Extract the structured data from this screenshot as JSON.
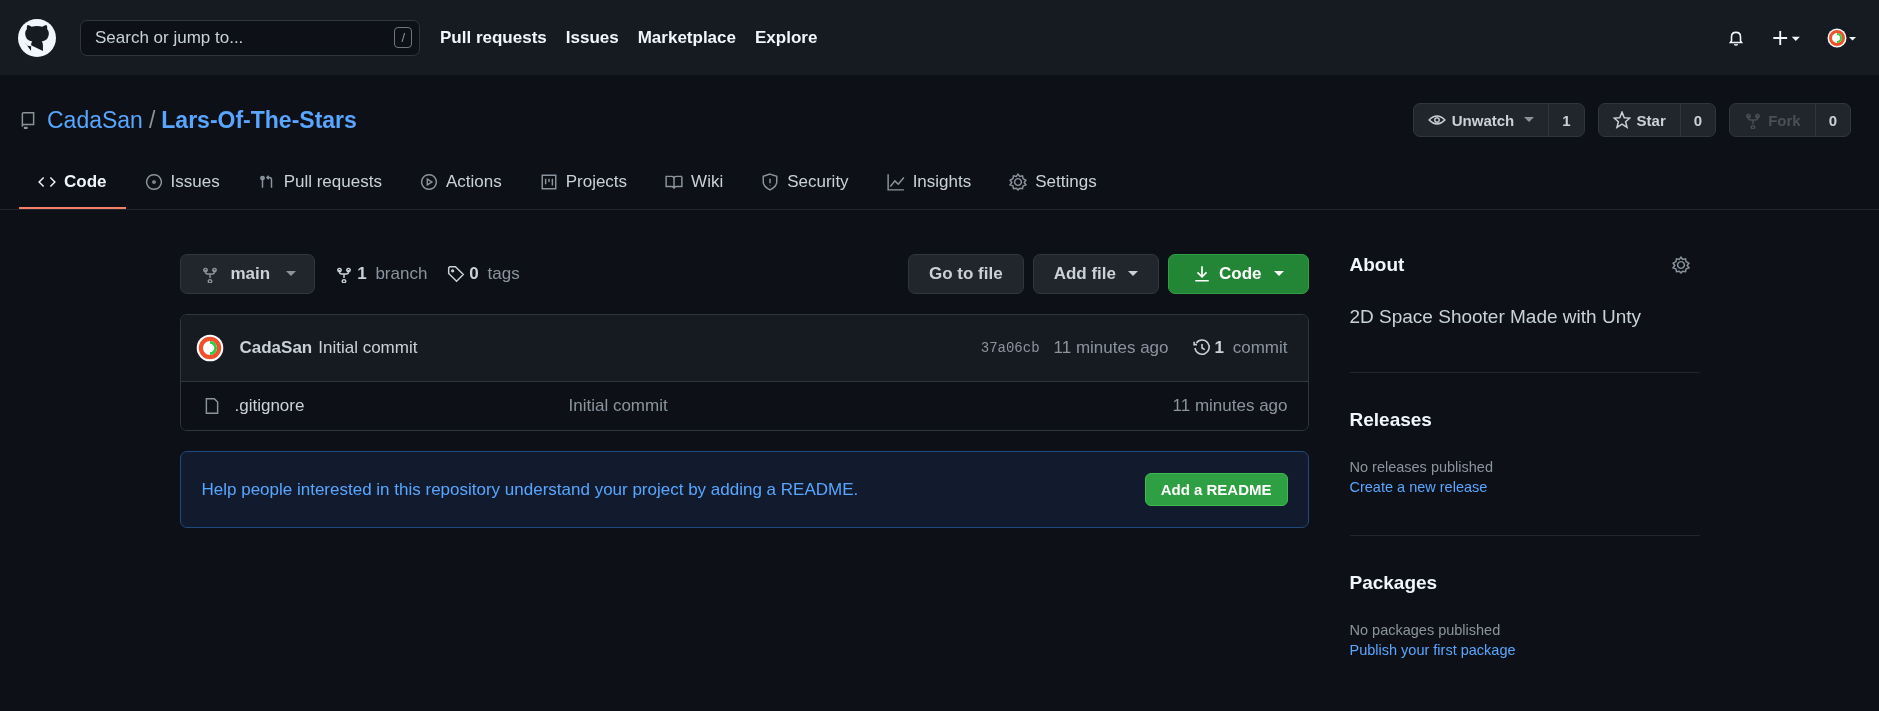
{
  "header": {
    "search": {
      "placeholder": "Search or jump to...",
      "shortcut": "/"
    },
    "nav": [
      "Pull requests",
      "Issues",
      "Marketplace",
      "Explore"
    ]
  },
  "repo": {
    "owner": "CadaSan",
    "separator": "/",
    "name": "Lars-Of-The-Stars",
    "actions": [
      {
        "kind": "watch",
        "label": "Unwatch",
        "count": "1",
        "disabled": false
      },
      {
        "kind": "star",
        "label": "Star",
        "count": "0",
        "disabled": false
      },
      {
        "kind": "fork",
        "label": "Fork",
        "count": "0",
        "disabled": true
      }
    ]
  },
  "tabs": [
    {
      "kind": "code",
      "label": "Code",
      "selected": true
    },
    {
      "kind": "issues",
      "label": "Issues",
      "selected": false
    },
    {
      "kind": "pulls",
      "label": "Pull requests",
      "selected": false
    },
    {
      "kind": "actions",
      "label": "Actions",
      "selected": false
    },
    {
      "kind": "projects",
      "label": "Projects",
      "selected": false
    },
    {
      "kind": "wiki",
      "label": "Wiki",
      "selected": false
    },
    {
      "kind": "security",
      "label": "Security",
      "selected": false
    },
    {
      "kind": "insights",
      "label": "Insights",
      "selected": false
    },
    {
      "kind": "settings",
      "label": "Settings",
      "selected": false
    }
  ],
  "branch_bar": {
    "branch": "main",
    "branches": {
      "count": "1",
      "label": "branch"
    },
    "tags": {
      "count": "0",
      "label": "tags"
    },
    "buttons": [
      {
        "kind": "plain",
        "label": "Go to file"
      },
      {
        "kind": "dropdown",
        "label": "Add file"
      },
      {
        "kind": "primary",
        "label": "Code"
      }
    ]
  },
  "latest_commit": {
    "author": "CadaSan",
    "message": "Initial commit",
    "sha": "37a06cb",
    "time": "11 minutes ago",
    "commits": {
      "count": "1",
      "label": "commit"
    }
  },
  "files": [
    {
      "name": ".gitignore",
      "message": "Initial commit",
      "time": "11 minutes ago"
    }
  ],
  "readme_prompt": {
    "text": "Help people interested in this repository understand your project by adding a README.",
    "button": "Add a README"
  },
  "sidebar": {
    "about": {
      "title": "About",
      "description": "2D Space Shooter Made with Unty"
    },
    "sections": [
      {
        "title": "Releases",
        "empty": "No releases published",
        "link": "Create a new release"
      },
      {
        "title": "Packages",
        "empty": "No packages published",
        "link": "Publish your first package"
      }
    ]
  }
}
